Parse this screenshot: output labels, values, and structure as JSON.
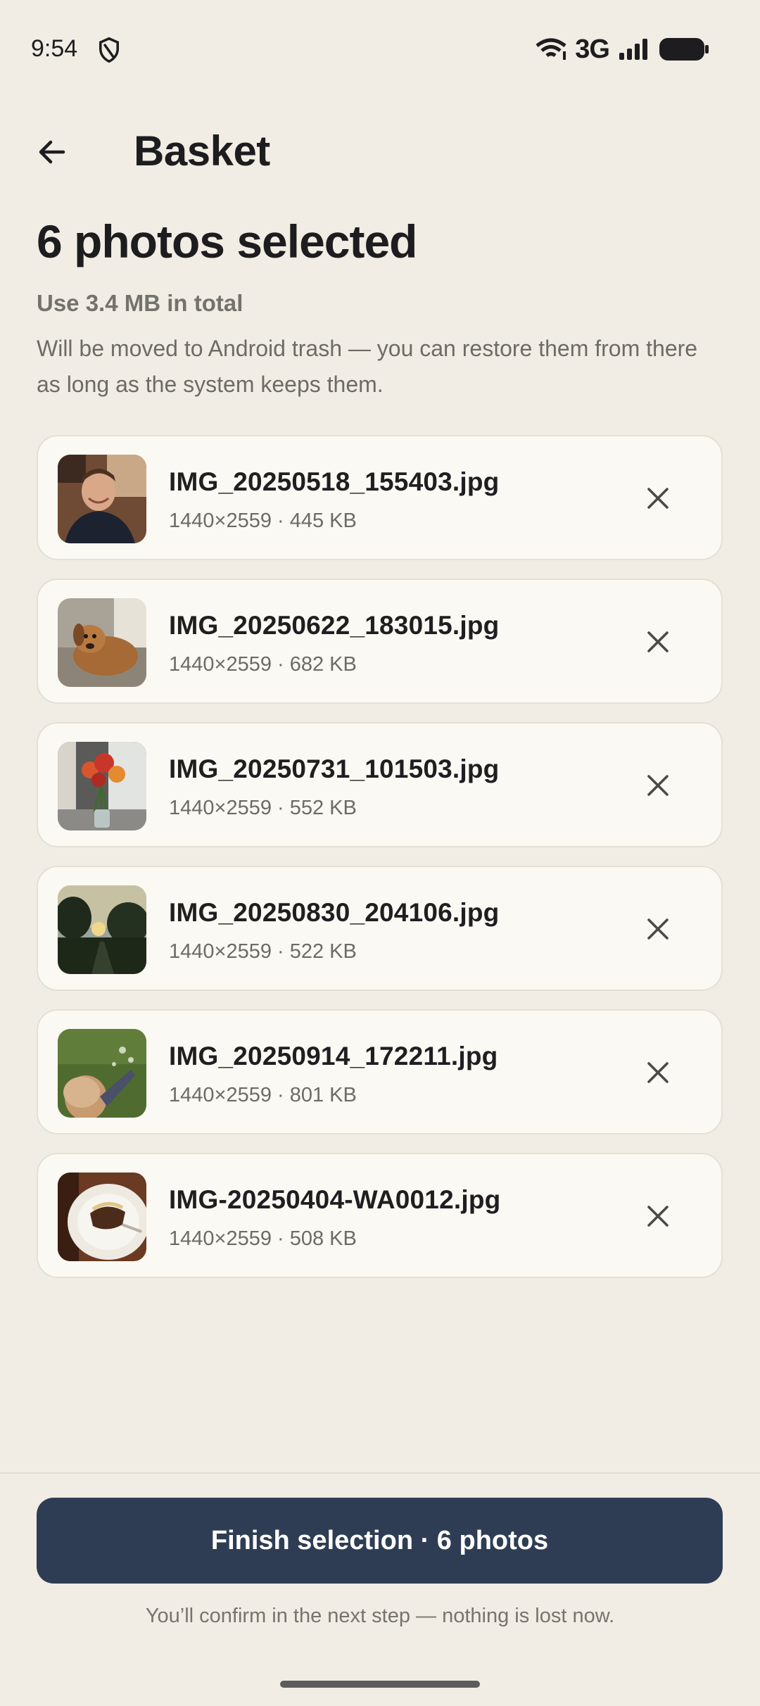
{
  "status_bar": {
    "time": "9:54",
    "network": "3G"
  },
  "app_bar": {
    "title": "Basket"
  },
  "summary": {
    "heading": "6 photos selected",
    "total": "Use 3.4 MB in total",
    "description": "Will be moved to Android trash — you can restore them from there as long as the system keeps them."
  },
  "photos": [
    {
      "name": "IMG_20250518_155403.jpg",
      "meta": "1440×2559 · 445 KB",
      "thumb": "man-smiling"
    },
    {
      "name": "IMG_20250622_183015.jpg",
      "meta": "1440×2559 · 682 KB",
      "thumb": "dog-on-couch"
    },
    {
      "name": "IMG_20250731_101503.jpg",
      "meta": "1440×2559 · 552 KB",
      "thumb": "flowers-vase"
    },
    {
      "name": "IMG_20250830_204106.jpg",
      "meta": "1440×2559 · 522 KB",
      "thumb": "sunset-trees"
    },
    {
      "name": "IMG_20250914_172211.jpg",
      "meta": "1440×2559 · 801 KB",
      "thumb": "child-grass"
    },
    {
      "name": "IMG-20250404-WA0012.jpg",
      "meta": "1440×2559 · 508 KB",
      "thumb": "cake-plate"
    }
  ],
  "footer": {
    "finish_label": "Finish selection · 6 photos",
    "note": "You’ll confirm in the next step — nothing is lost now."
  },
  "colors": {
    "background": "#f1ede4",
    "card": "#fbf9f3",
    "button": "#2f3d54"
  }
}
